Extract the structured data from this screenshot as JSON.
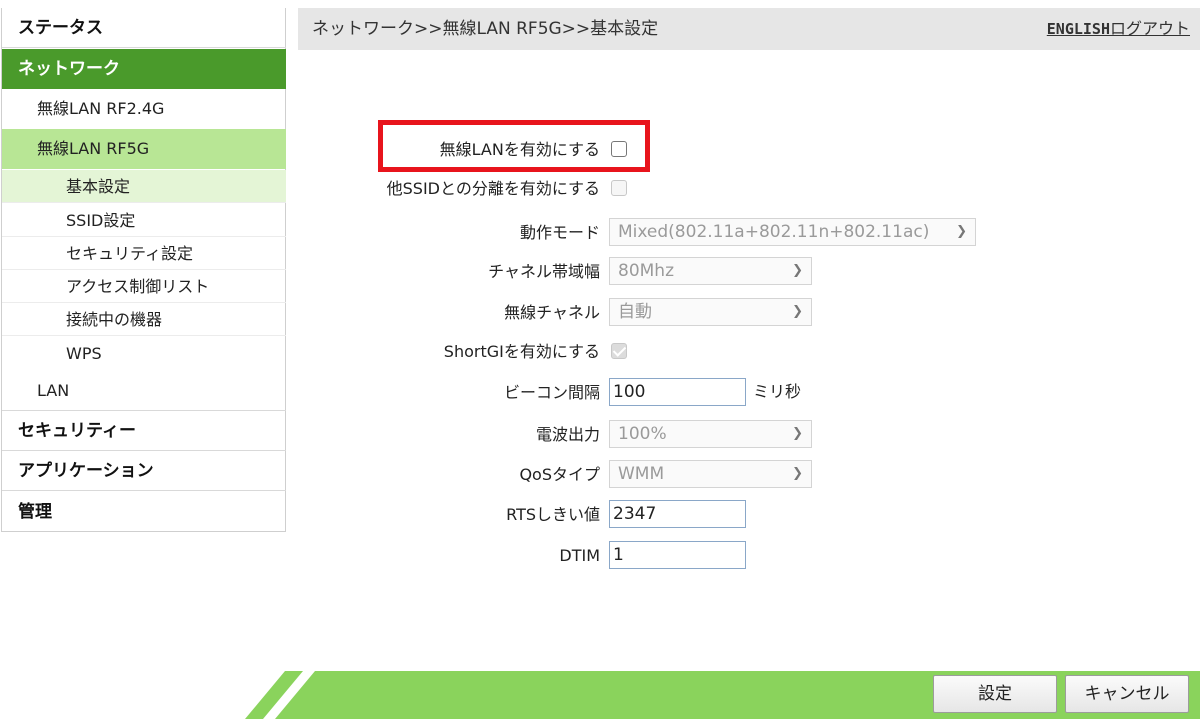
{
  "sidebar": {
    "status": "ステータス",
    "network": "ネットワーク",
    "wlan24": "無線LAN RF2.4G",
    "wlan5": "無線LAN RF5G",
    "basic": "基本設定",
    "ssid": "SSID設定",
    "security_setting": "セキュリティ設定",
    "acl": "アクセス制御リスト",
    "connected": "接続中の機器",
    "wps": "WPS",
    "lan": "LAN",
    "security": "セキュリティー",
    "application": "アプリケーション",
    "admin": "管理"
  },
  "header": {
    "breadcrumb": "ネットワーク>>無線LAN RF5G>>基本設定",
    "english": "ENGLISH",
    "logout": "ログアウト"
  },
  "form": {
    "enable_wlan_label": "無線LANを有効にする",
    "enable_wlan_checked": false,
    "ssid_isolation_label": "他SSIDとの分離を有効にする",
    "ssid_isolation_checked": false,
    "mode_label": "動作モード",
    "mode_value": "Mixed(802.11a+802.11n+802.11ac)",
    "bandwidth_label": "チャネル帯域幅",
    "bandwidth_value": "80Mhz",
    "channel_label": "無線チャネル",
    "channel_value": "自動",
    "shortgi_label": "ShortGIを有効にする",
    "shortgi_checked": true,
    "beacon_label": "ビーコン間隔",
    "beacon_value": "100",
    "beacon_unit": "ミリ秒",
    "power_label": "電波出力",
    "power_value": "100%",
    "qos_label": "QoSタイプ",
    "qos_value": "WMM",
    "rts_label": "RTSしきい値",
    "rts_value": "2347",
    "dtim_label": "DTIM",
    "dtim_value": "1"
  },
  "buttons": {
    "apply": "設定",
    "cancel": "キャンセル"
  },
  "colors": {
    "sidebar_active": "#4a9a2b",
    "submenu_active": "#b8e695",
    "bottom_bar": "#8ad35c",
    "highlight": "#e8141c"
  }
}
